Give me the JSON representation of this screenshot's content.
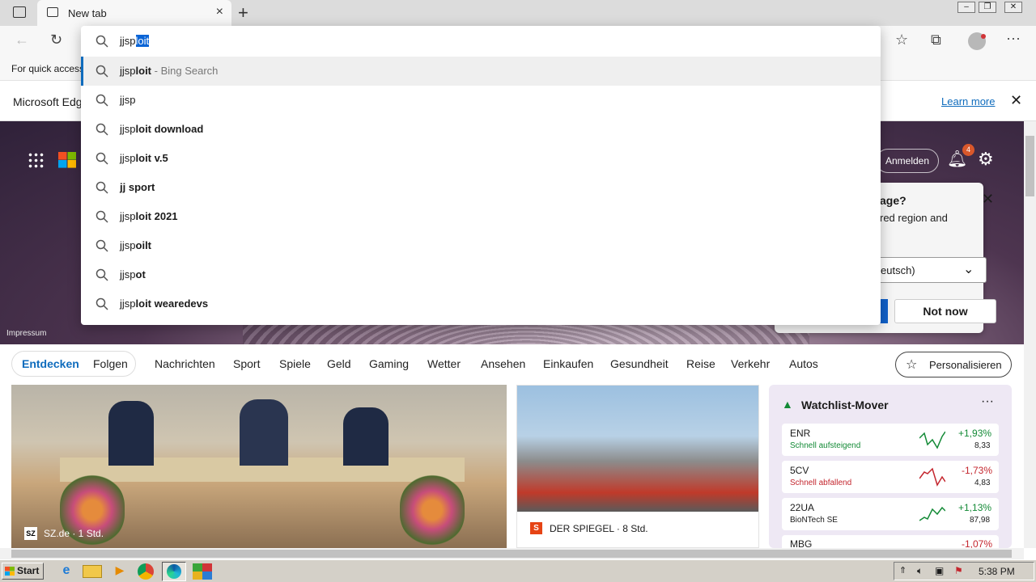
{
  "browser": {
    "tab_title": "New tab",
    "favorites_hint": "For quick access",
    "infobar_text": "Microsoft Edg",
    "infobar_link": "Learn more",
    "omnibox_typed": "jjsp",
    "omnibox_selected": "loit"
  },
  "suggestions": [
    {
      "plain": "jjsp",
      "bold": "loit",
      "suffix": " - Bing Search"
    },
    {
      "plain": "jjsp",
      "bold": "",
      "suffix": ""
    },
    {
      "plain": "jjsp",
      "bold": "loit download",
      "suffix": ""
    },
    {
      "plain": "jjsp",
      "bold": "loit v.5",
      "suffix": ""
    },
    {
      "plain": "",
      "bold": "jj sport",
      "suffix": ""
    },
    {
      "plain": "jjsp",
      "bold": "loit 2021",
      "suffix": ""
    },
    {
      "plain": "jjsp",
      "bold": "oilt",
      "suffix": ""
    },
    {
      "plain": "jjsp",
      "bold": "ot",
      "suffix": ""
    },
    {
      "plain": "jjsp",
      "bold": "loit wearedevs",
      "suffix": ""
    }
  ],
  "header": {
    "signin": "Anmelden",
    "notif_count": "4",
    "impressum": "Impressum"
  },
  "popup": {
    "line1": "age?",
    "line2": "red region and",
    "select_value": "eutsch)",
    "not_now": "Not now"
  },
  "nav": {
    "tabs": [
      "Entdecken",
      "Folgen"
    ],
    "items": [
      "Nachrichten",
      "Sport",
      "Spiele",
      "Geld",
      "Gaming",
      "Wetter",
      "Ansehen",
      "Einkaufen",
      "Gesundheit",
      "Reise",
      "Verkehr",
      "Autos"
    ],
    "personalize": "Personalisieren"
  },
  "cards": {
    "card1_source": "SZ.de · 1 Std.",
    "card2_source": "DER SPIEGEL · 8 Std.",
    "watchlist_title": "Watchlist-Mover",
    "stocks": [
      {
        "sym": "ENR",
        "sub": "Schnell aufsteigend",
        "pct": "+1,93%",
        "price": "8,33",
        "up": true
      },
      {
        "sym": "5CV",
        "sub": "Schnell abfallend",
        "pct": "-1,73%",
        "price": "4,83",
        "up": false
      },
      {
        "sym": "22UA",
        "sub": "BioNTech SE",
        "pct": "+1,13%",
        "price": "87,98",
        "up": true
      },
      {
        "sym": "MBG",
        "sub": "",
        "pct": "-1,07%",
        "price": "",
        "up": false
      }
    ]
  },
  "taskbar": {
    "start": "Start",
    "clock": "5:38 PM"
  },
  "colors": {
    "accent": "#0f6cbd",
    "up": "#138a36",
    "down": "#c4262e"
  }
}
